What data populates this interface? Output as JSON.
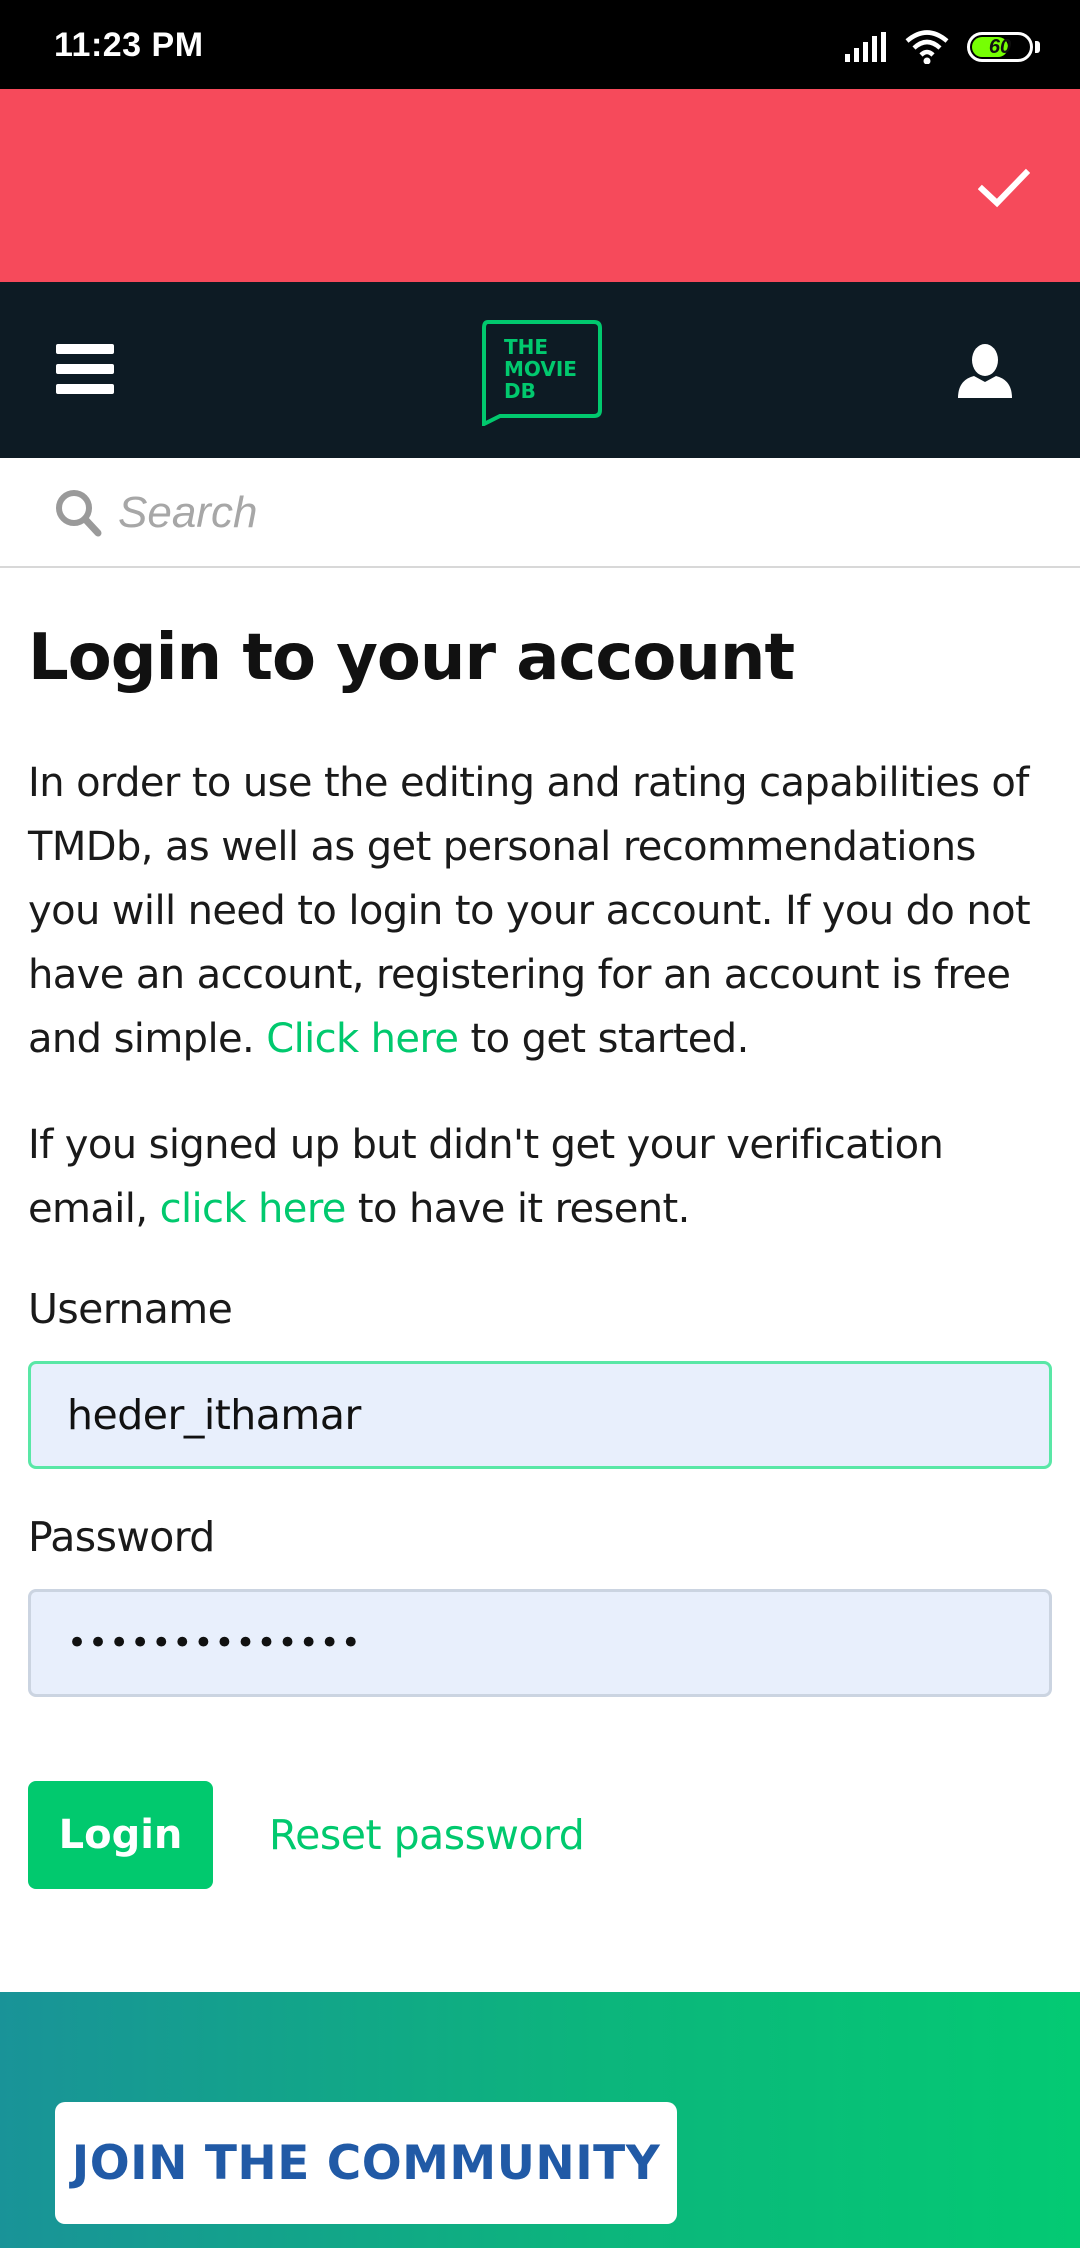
{
  "status_bar": {
    "time": "11:23 PM",
    "battery": "60",
    "icons": [
      "signal-icon",
      "wifi-icon",
      "battery-icon"
    ]
  },
  "banner": {
    "color": "#f64a5b",
    "icon": "check-icon"
  },
  "nav": {
    "menu_icon": "hamburger-menu-icon",
    "logo_lines": [
      "THE",
      "MOVIE",
      "DB"
    ],
    "user_icon": "user-icon"
  },
  "search": {
    "placeholder": "Search",
    "icon": "search-icon"
  },
  "page": {
    "title": "Login to your account",
    "intro_text": "In order to use the editing and rating capabilities of TMDb, as well as get personal recommendations you will need to login to your account. If you do not have an account, registering for an account is free and simple.",
    "intro_link": "Click here",
    "intro_after": "to get started.",
    "verify_text": "If you signed up but didn't get your verification email,",
    "verify_link": "click here",
    "verify_after": "to have it resent."
  },
  "form": {
    "username_label": "Username",
    "username_value": "heder_ithamar",
    "password_label": "Password",
    "password_value": "••••••••••••••",
    "login_label": "Login",
    "reset_label": "Reset password"
  },
  "community": {
    "join_label": "JOIN THE COMMUNITY"
  },
  "colors": {
    "accent_green": "#01c96e",
    "nav_dark": "#0d1b24",
    "banner_red": "#f64a5b",
    "join_text_blue": "#215aa6"
  }
}
